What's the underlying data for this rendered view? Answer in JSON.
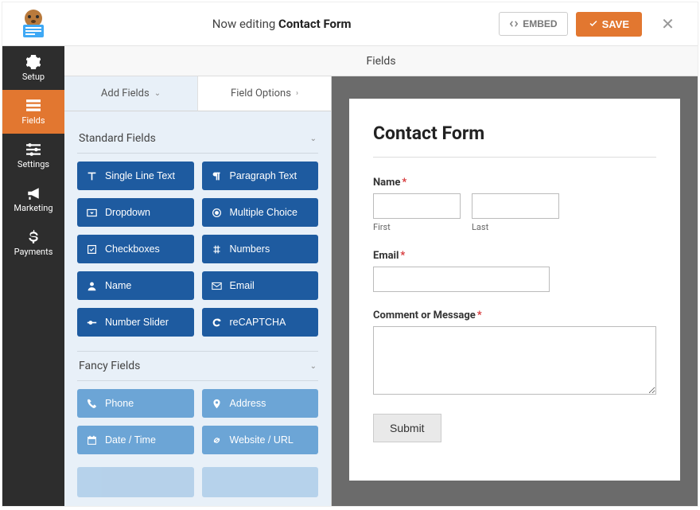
{
  "header": {
    "editing_prefix": "Now editing ",
    "form_name": "Contact Form",
    "embed_label": "EMBED",
    "save_label": "SAVE"
  },
  "sidebar": {
    "items": [
      {
        "label": "Setup"
      },
      {
        "label": "Fields"
      },
      {
        "label": "Settings"
      },
      {
        "label": "Marketing"
      },
      {
        "label": "Payments"
      }
    ],
    "active_index": 1
  },
  "section_title": "Fields",
  "tabs": {
    "add_fields": "Add Fields",
    "field_options": "Field Options"
  },
  "groups": {
    "standard": {
      "title": "Standard Fields",
      "fields": [
        "Single Line Text",
        "Paragraph Text",
        "Dropdown",
        "Multiple Choice",
        "Checkboxes",
        "Numbers",
        "Name",
        "Email",
        "Number Slider",
        "reCAPTCHA"
      ]
    },
    "fancy": {
      "title": "Fancy Fields",
      "fields": [
        "Phone",
        "Address",
        "Date / Time",
        "Website / URL"
      ]
    }
  },
  "preview": {
    "form_title": "Contact Form",
    "name_label": "Name",
    "first_label": "First",
    "last_label": "Last",
    "email_label": "Email",
    "comment_label": "Comment or Message",
    "submit_label": "Submit",
    "required_mark": "*"
  },
  "colors": {
    "accent_orange": "#e27730",
    "primary_blue": "#1e5ba0",
    "fancy_blue": "#6ca5d6"
  }
}
